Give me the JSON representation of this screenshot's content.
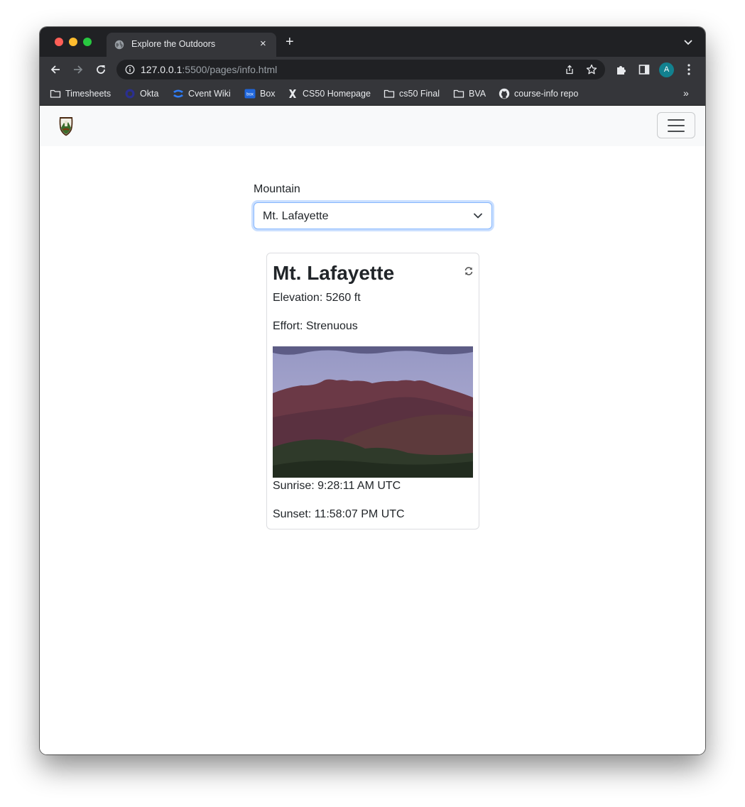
{
  "browser": {
    "tab_title": "Explore the Outdoors",
    "tab_close": "×",
    "new_tab": "+",
    "url_host": "127.0.0.1",
    "url_path": ":5500/pages/info.html",
    "avatar_letter": "A",
    "bookmarks": [
      {
        "label": "Timesheets",
        "icon": "folder-icon"
      },
      {
        "label": "Okta",
        "icon": "okta-icon"
      },
      {
        "label": "Cvent Wiki",
        "icon": "confluence-icon"
      },
      {
        "label": "Box",
        "icon": "box-icon"
      },
      {
        "label": "CS50 Homepage",
        "icon": "cs50-icon"
      },
      {
        "label": "cs50 Final",
        "icon": "folder-icon"
      },
      {
        "label": "BVA",
        "icon": "folder-icon"
      },
      {
        "label": "course-info repo",
        "icon": "github-icon"
      }
    ],
    "bookmarks_more": "»"
  },
  "page": {
    "form_label": "Mountain",
    "selected_mountain": "Mt. Lafayette",
    "card": {
      "title": "Mt. Lafayette",
      "elevation": "Elevation: 5260 ft",
      "effort": "Effort: Strenuous",
      "image": "mountain-photo",
      "sunrise": "Sunrise: 9:28:11 AM UTC",
      "sunset": "Sunset: 11:58:07 PM UTC"
    }
  },
  "colors": {
    "tab_strip": "#202124",
    "toolbar": "#35363a",
    "navbar_bg": "#f8f9fa",
    "select_focus": "#86b7fe"
  }
}
